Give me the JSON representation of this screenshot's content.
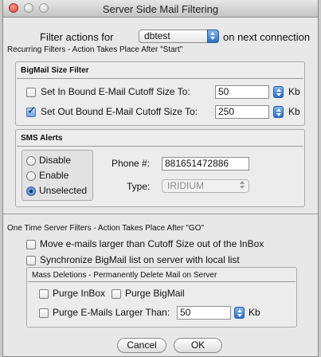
{
  "window": {
    "title": "Server Side Mail Filtering"
  },
  "filter": {
    "prefix": "Filter actions for",
    "account": "dbtest",
    "suffix": "on next connection"
  },
  "recurring": {
    "heading": "Recurring Filters - Action Takes Place After \"Start\"",
    "bigmail": {
      "title": "BigMail Size Filter",
      "inbound": {
        "label": "Set In Bound E-Mail Cutoff Size To:",
        "checked": false,
        "value": "50",
        "unit": "Kb"
      },
      "outbound": {
        "label": "Set Out Bound E-Mail Cutoff Size To:",
        "checked": true,
        "value": "250",
        "unit": "Kb"
      }
    },
    "sms": {
      "title": "SMS Alerts",
      "options": [
        "Disable",
        "Enable",
        "Unselected"
      ],
      "selected": "Unselected",
      "phone_label": "Phone #:",
      "phone_value": "881651472886",
      "type_label": "Type:",
      "type_value": "IRIDIUM"
    }
  },
  "onetime": {
    "heading": "One Time Server Filters  - Action Takes Place After \"GO\"",
    "move_large": {
      "label": "Move e-mails larger than Cutoff Size out of the InBox",
      "checked": false
    },
    "sync": {
      "label": "Synchronize BigMail list on server with local list",
      "checked": false
    },
    "mass": {
      "title": "Mass Deletions - Permanently Delete Mail on Server",
      "purge_inbox": {
        "label": "Purge InBox",
        "checked": false
      },
      "purge_bigmail": {
        "label": "Purge BigMail",
        "checked": false
      },
      "purge_larger": {
        "label": "Purge E-Mails Larger Than:",
        "checked": false,
        "value": "50",
        "unit": "Kb"
      }
    }
  },
  "buttons": {
    "cancel": "Cancel",
    "ok": "OK"
  }
}
